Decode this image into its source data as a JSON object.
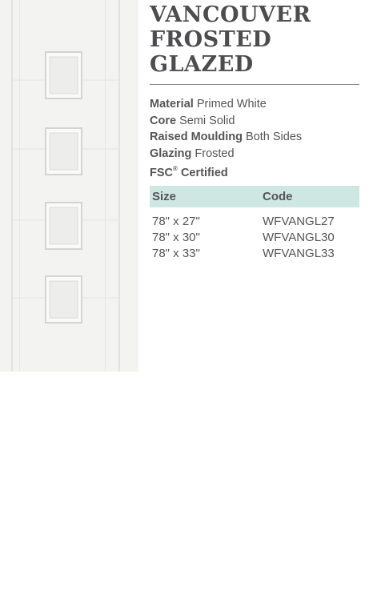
{
  "product": {
    "title_lines": [
      "VANCOUVER",
      "FROSTED",
      "GLAZED"
    ],
    "specs": [
      {
        "label": "Material",
        "value": "Primed White"
      },
      {
        "label": "Core",
        "value": "Semi Solid"
      },
      {
        "label": "Raised Moulding",
        "value": "Both Sides"
      },
      {
        "label": "Glazing",
        "value": "Frosted"
      }
    ],
    "fsc": {
      "mark": "FSC",
      "reg": "®",
      "text": "Certified"
    }
  },
  "table": {
    "headers": {
      "size": "Size",
      "code": "Code"
    },
    "rows": [
      {
        "size": "78\" x 27\"",
        "code": "WFVANGL27"
      },
      {
        "size": "78\" x 30\"",
        "code": "WFVANGL30"
      },
      {
        "size": "78\" x 33\"",
        "code": "WFVANGL33"
      }
    ],
    "header_color": "#cfe7e3"
  },
  "image": {
    "icon": "white-door-with-four-frosted-square-glazed-panels"
  }
}
